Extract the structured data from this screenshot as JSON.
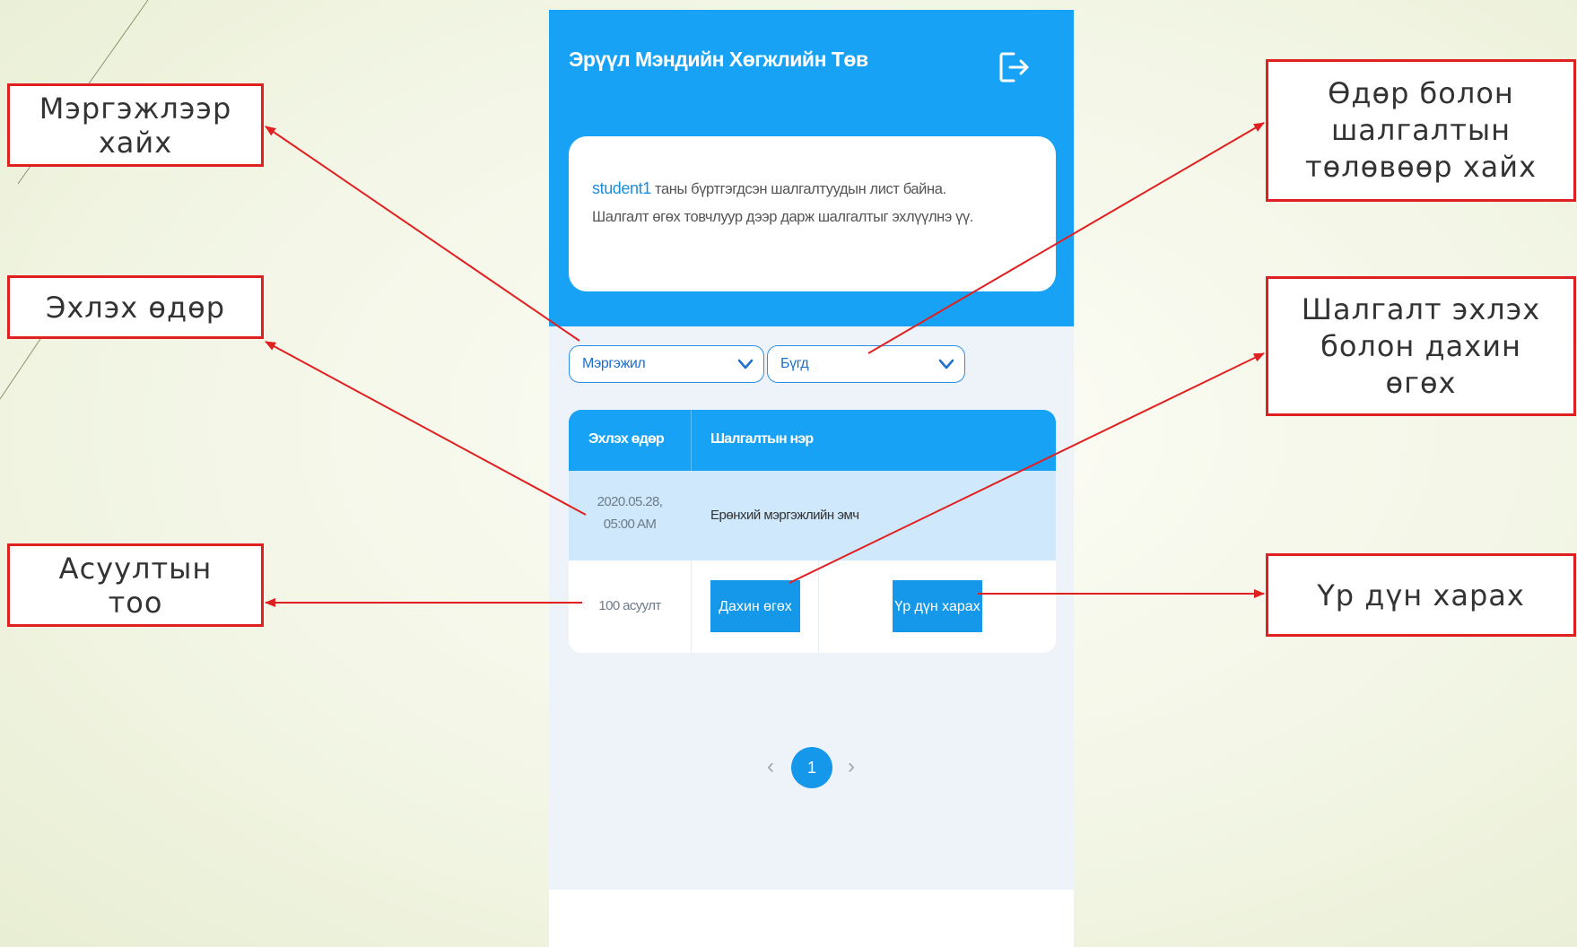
{
  "app": {
    "title": "Эрүүл Мэндийн Хөгжлийн Төв",
    "logout_icon": "logout-icon"
  },
  "info": {
    "username": "student1",
    "message_line1": " таны бүртгэгдсэн шалгалтуудын лист байна.",
    "message_line2": "Шалгалт өгөх товчлуур дээр дарж шалгалтыг эхлүүлнэ үү."
  },
  "filters": {
    "profession_value": "Мэргэжил",
    "status_value": "Бүгд"
  },
  "table": {
    "headers": [
      "Эхлэх өдөр",
      "Шалгалтын нэр"
    ],
    "rows": [
      {
        "date_line1": "2020.05.28,",
        "date_line2": "05:00 AM",
        "exam_name": "Ерөнхий мэргэжлийн эмч"
      }
    ],
    "question_count": "100 асуулт",
    "retake_button": "Дахин өгөх",
    "result_button": "Үр дүн харах"
  },
  "pagination": {
    "prev": "‹",
    "current": "1",
    "next": "›"
  },
  "callouts": {
    "search_by_profession": "Мэргэжлээр хайх",
    "start_date": "Эхлэх өдөр",
    "question_count": "Асуултын тоо",
    "search_by_date_status": "Өдөр болон шалгалтын төлөвөөр хайх",
    "start_and_retake": "Шалгалт эхлэх болон дахин өгөх",
    "view_result": "Үр дүн харах"
  },
  "colors": {
    "primary": "#17a2f5",
    "button": "#1597ea",
    "callout_border": "#e02020",
    "row_highlight": "#cfe8fb"
  }
}
